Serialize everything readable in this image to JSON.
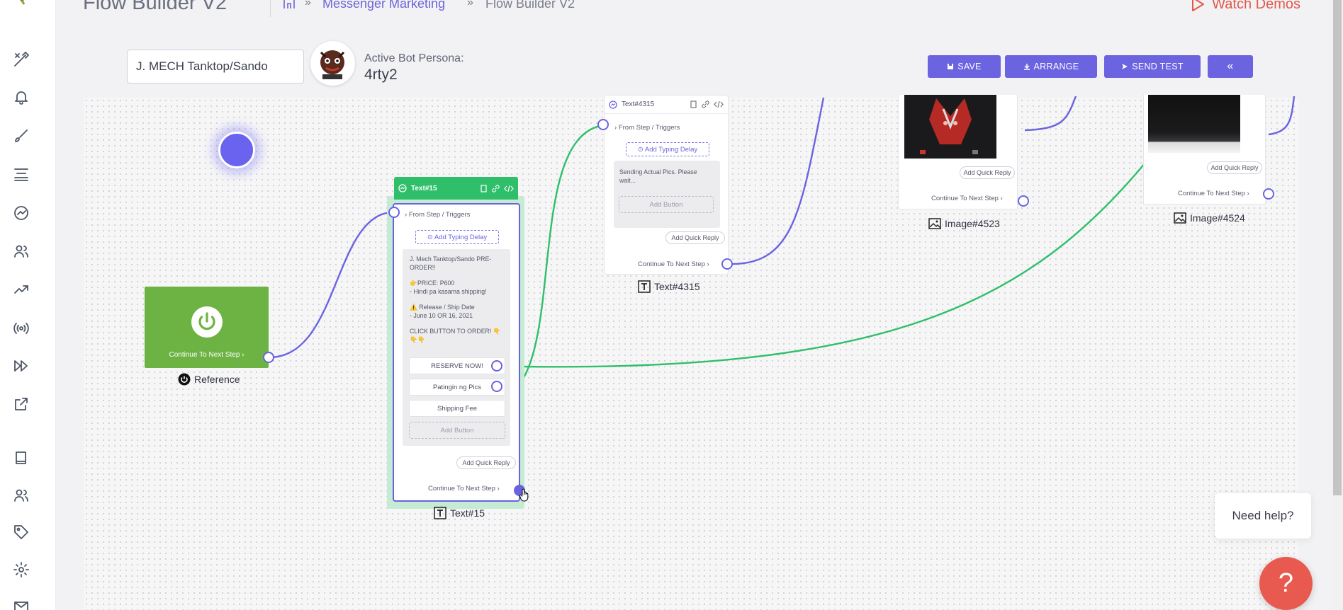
{
  "header": {
    "title": "Flow Builder V2",
    "breadcrumb": {
      "separator": "»",
      "link": "Messenger Marketing",
      "current": "Flow Builder V2"
    },
    "watch_demos": "Watch Demos"
  },
  "sidebar": {
    "items": [
      {
        "icon": "tools-icon"
      },
      {
        "icon": "bell-icon"
      },
      {
        "icon": "brush-icon"
      },
      {
        "icon": "stack-icon"
      },
      {
        "icon": "messenger-icon"
      },
      {
        "icon": "users-icon"
      },
      {
        "icon": "trend-icon"
      },
      {
        "icon": "broadcast-icon"
      },
      {
        "icon": "fast-forward-icon"
      },
      {
        "icon": "external-link-icon"
      },
      {
        "icon": "book-icon"
      },
      {
        "icon": "users-icon"
      },
      {
        "icon": "tag-icon"
      },
      {
        "icon": "gear-icon"
      },
      {
        "icon": "mail-icon"
      }
    ]
  },
  "toolbar": {
    "flow_name": "J. MECH Tanktop/Sando",
    "persona_label": "Active Bot Persona:",
    "persona_name": "4rty2",
    "buttons": {
      "save": "SAVE",
      "arrange": "ARRANGE",
      "send_test": "SEND TEST",
      "collapse": "«"
    }
  },
  "nodes": {
    "reference": {
      "continue": "Continue To Next Step",
      "caption": "Reference"
    },
    "text15": {
      "header": "Text#15",
      "from": "From Step / Triggers",
      "typing": "⊙ Add Typing Delay",
      "message": {
        "line1": "J. Mech Tanktop/Sando PRE-",
        "line2": "ORDER!!",
        "line3": "👉PRICE: P600",
        "line4": "- Hindi pa kasama shipping!",
        "line5": "⚠️ Release / Ship Date",
        "line6": "- June 10 OR 16, 2021",
        "line7": "CLICK BUTTON TO ORDER! 👇",
        "line8": "👇👇"
      },
      "buttons": [
        "RESERVE NOW!",
        "Patingin ng Pics",
        "Shipping Fee"
      ],
      "add_button": "Add Button",
      "quick_reply": "Add Quick Reply",
      "continue": "Continue To Next Step",
      "caption": "Text#15"
    },
    "text4315": {
      "header": "Text#4315",
      "from": "From Step / Triggers",
      "typing": "⊙ Add Typing Delay",
      "message_line1": "Sending Actual Pics. Please",
      "message_line2": "wait...",
      "add_button": "Add Button",
      "quick_reply": "Add Quick Reply",
      "continue": "Continue To Next Step",
      "caption": "Text#4315"
    },
    "image4523": {
      "quick_reply": "Add Quick Reply",
      "continue": "Continue To Next Step",
      "caption": "Image#4523"
    },
    "image4524": {
      "quick_reply": "Add Quick Reply",
      "continue": "Continue To Next Step",
      "caption": "Image#4524"
    }
  },
  "help": {
    "need_help": "Need help?",
    "fab": "?"
  },
  "colors": {
    "accent": "#6c63e0",
    "green": "#2fbf6a",
    "start_green": "#6cb344",
    "help": "#e85a4f"
  }
}
